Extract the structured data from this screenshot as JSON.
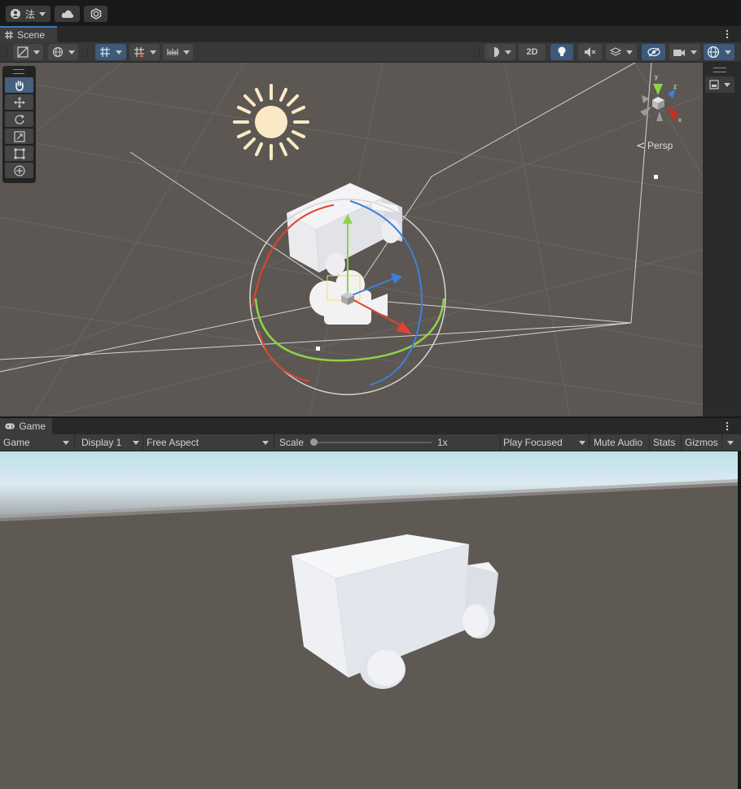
{
  "topbar": {
    "account_label": "法",
    "cloud_icon": "cloud-icon",
    "collab_icon": "collab-icon"
  },
  "scene": {
    "tab_label": "Scene",
    "toolbar": {
      "mode_2d_label": "2D"
    },
    "orientation_label": "Persp",
    "gizmo_axes": {
      "x": "x",
      "y": "y",
      "z": "z"
    },
    "tools": [
      "hand-tool",
      "move-tool",
      "rotate-tool",
      "scale-tool",
      "rect-tool",
      "transform-tool"
    ]
  },
  "game": {
    "tab_label": "Game",
    "view_mode": "Game",
    "display": "Display 1",
    "aspect": "Free Aspect",
    "scale_label": "Scale",
    "scale_value": "1x",
    "scale_level": 0,
    "play_mode": "Play Focused",
    "mute_audio": "Mute Audio",
    "stats": "Stats",
    "gizmos": "Gizmos"
  },
  "colors": {
    "accent": "#3a79bb",
    "viewport_bg": "#5c5752",
    "axis_x": "#e0432f",
    "axis_y": "#8ed24a",
    "axis_z": "#3d7fe0",
    "sun": "#fbe9c5"
  }
}
